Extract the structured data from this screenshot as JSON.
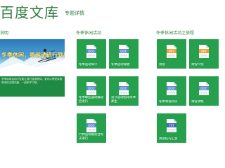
{
  "header": {
    "app_title": "百度文库",
    "subtitle": "专题详情"
  },
  "sections": {
    "intro_title": "说明",
    "activities_title": "冬季休闲活动",
    "travel_title": "冬季休闲活动之旅程"
  },
  "hero": {
    "caption": "冬季休闲，将运动进行到底",
    "description": "冬季休闲活动不仅能让我们强身健体，更可以享受冰雪带来的无限乐趣，一起来学习吧。"
  },
  "colors": {
    "tile_green": "#27a04e",
    "title_green": "#2f7d3f",
    "doc_icon_blue": "#5b8fc9",
    "ppt_icon_orange": "#e9a23b",
    "txt_icon_blue": "#3d6eb5"
  },
  "tiles": [
    {
      "label": "冬季运动简介",
      "type": "DOC",
      "icon": "doc-icon"
    },
    {
      "label": "冬季运动保健",
      "type": "DOC",
      "icon": "doc-icon"
    },
    {
      "label": "冬季哪些运动最适合进行",
      "type": "DOC",
      "icon": "doc-icon"
    },
    {
      "label": "双节运动指南冬季养生",
      "type": "DOC",
      "icon": "doc-icon"
    },
    {
      "label": "六种运动最适合冬天进行",
      "type": "DOC",
      "icon": "doc-icon"
    },
    {
      "label": "滑雪",
      "type": "PPT",
      "icon": "ppt-icon"
    },
    {
      "label": "滑雪介绍",
      "type": "PPT",
      "icon": "ppt-icon"
    },
    {
      "label": "冬季滑雪知识",
      "type": "DOC",
      "icon": "doc-icon"
    },
    {
      "label": "滑雪攻略",
      "type": "DOC",
      "icon": "doc-icon"
    },
    {
      "label": "滑雪技巧汇总",
      "type": "TXT",
      "icon": "txt-icon"
    }
  ]
}
